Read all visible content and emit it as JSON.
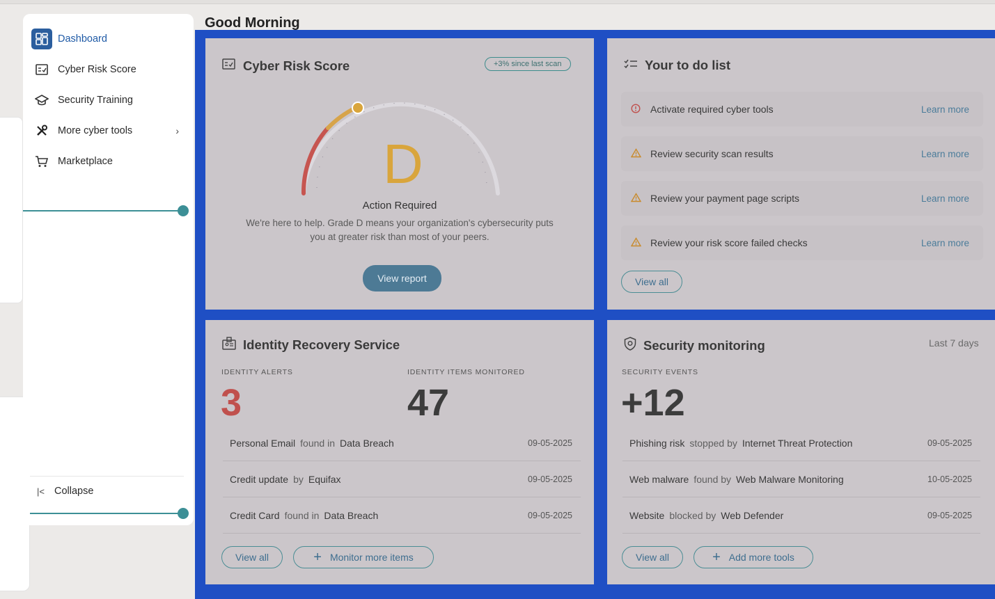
{
  "greeting": "Good Morning",
  "sidebar": {
    "items": [
      {
        "label": "Dashboard",
        "icon": "dashboard-icon",
        "active": true
      },
      {
        "label": "Cyber Risk Score",
        "icon": "scorecard-icon"
      },
      {
        "label": "Security Training",
        "icon": "graduation-cap-icon"
      },
      {
        "label": "More cyber tools",
        "icon": "tools-icon",
        "has_submenu": true
      },
      {
        "label": "Marketplace",
        "icon": "cart-icon"
      }
    ],
    "collapse_label": "Collapse"
  },
  "cyber_risk": {
    "title": "Cyber Risk Score",
    "badge": "+3% since last scan",
    "grade": "D",
    "status": "Action Required",
    "description_line1": "We're here to help. Grade D means your organization's cybersecurity puts",
    "description_line2": "you at greater risk than most of your peers.",
    "button": "View report"
  },
  "todo": {
    "title": "Your to do list",
    "items": [
      {
        "text": "Activate required cyber tools",
        "link": "Learn more",
        "severity": "critical"
      },
      {
        "text": "Review security scan results",
        "link": "Learn more",
        "severity": "warning"
      },
      {
        "text": "Review your payment page scripts",
        "link": "Learn more",
        "severity": "warning"
      },
      {
        "text": "Review your risk score failed checks",
        "link": "Learn more",
        "severity": "warning"
      }
    ],
    "view_all": "View all"
  },
  "identity": {
    "title": "Identity Recovery Service",
    "alerts_label": "IDENTITY ALERTS",
    "alerts_value": "3",
    "monitored_label": "IDENTITY ITEMS MONITORED",
    "monitored_value": "47",
    "rows": [
      {
        "subject": "Personal Email",
        "verb": "found in",
        "source": "Data Breach",
        "date": "09-05-2025"
      },
      {
        "subject": "Credit update",
        "verb": "by",
        "source": "Equifax",
        "date": "09-05-2025"
      },
      {
        "subject": "Credit Card",
        "verb": "found in",
        "source": "Data Breach",
        "date": "09-05-2025"
      }
    ],
    "view_all": "View all",
    "monitor_more": "Monitor more items"
  },
  "security": {
    "title": "Security monitoring",
    "period": "Last 7 days",
    "events_label": "SECURITY EVENTS",
    "events_value": "+12",
    "rows": [
      {
        "subject": "Phishing risk",
        "verb": "stopped by",
        "source": "Internet Threat Protection",
        "date": "09-05-2025"
      },
      {
        "subject": "Web malware",
        "verb": "found by",
        "source": "Web Malware Monitoring",
        "date": "10-05-2025"
      },
      {
        "subject": "Website",
        "verb": "blocked by",
        "source": "Web Defender",
        "date": "09-05-2025"
      }
    ],
    "view_all": "View all",
    "add_tools": "Add more tools"
  },
  "colors": {
    "accent": "#2b5e9e",
    "frame_blue": "#1f4fc4",
    "grade_amber": "#d9a53c",
    "alert_red": "#c0504d",
    "teal": "#3c8f96"
  }
}
